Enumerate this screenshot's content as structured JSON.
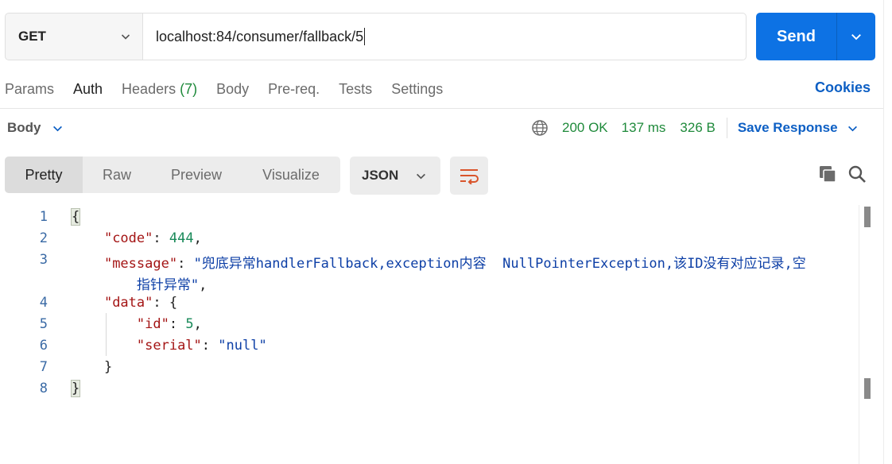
{
  "request": {
    "method": "GET",
    "url": "localhost:84/consumer/fallback/5",
    "send_label": "Send"
  },
  "request_tabs": [
    {
      "label": "Params"
    },
    {
      "label": "Auth"
    },
    {
      "label": "Headers",
      "count": "(7)"
    },
    {
      "label": "Body"
    },
    {
      "label": "Pre-req."
    },
    {
      "label": "Tests"
    },
    {
      "label": "Settings"
    }
  ],
  "cookies_label": "Cookies",
  "response": {
    "body_label": "Body",
    "status": "200 OK",
    "time": "137 ms",
    "size": "326 B",
    "save_label": "Save Response"
  },
  "format_tabs": [
    "Pretty",
    "Raw",
    "Preview",
    "Visualize"
  ],
  "format_select": "JSON",
  "code": {
    "line_numbers": [
      "1",
      "2",
      "3",
      "4",
      "5",
      "6",
      "7",
      "8"
    ],
    "open_brace": "{",
    "close_brace": "}",
    "code_key": "\"code\"",
    "code_value": "444",
    "message_key": "\"message\"",
    "message_value_line1": "\"兜底异常handlerFallback,exception内容  NullPointerException,该ID没有对应记录,空",
    "message_value_line2": "指针异常\"",
    "data_key": "\"data\"",
    "id_key": "\"id\"",
    "id_value": "5",
    "serial_key": "\"serial\"",
    "serial_value": "\"null\""
  },
  "colors": {
    "send": "#0d72e4",
    "status_green": "#1f8a3b",
    "link_blue": "#0d5fc4",
    "json_key": "#a41515",
    "json_number": "#1a8a5a",
    "json_string": "#0d3fa6"
  }
}
